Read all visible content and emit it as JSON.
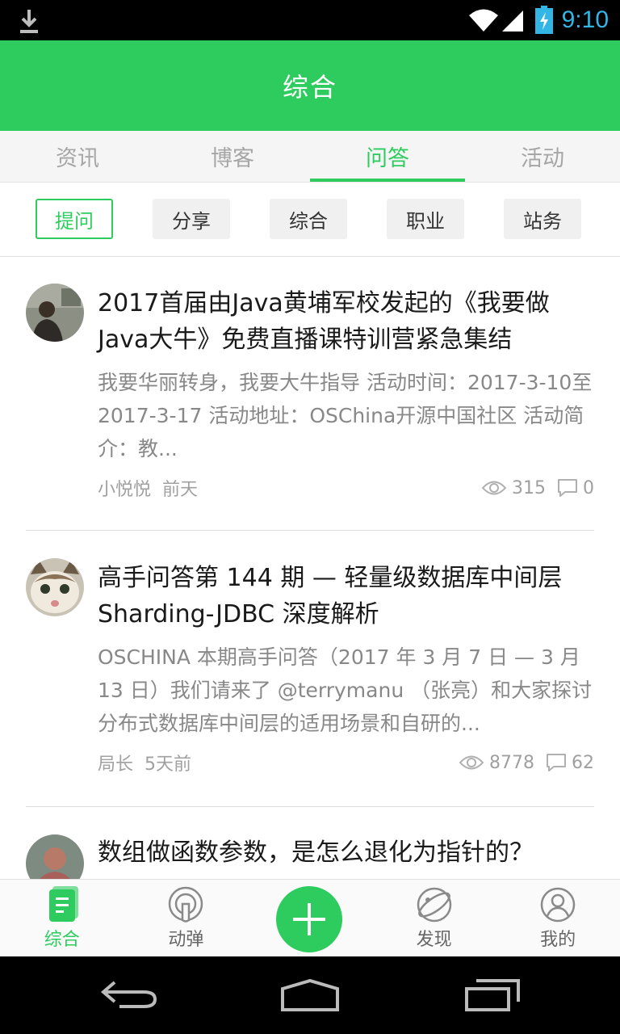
{
  "status_bar": {
    "time": "9:10"
  },
  "header": {
    "title": "综合"
  },
  "tabs": [
    {
      "label": "资讯"
    },
    {
      "label": "博客"
    },
    {
      "label": "问答"
    },
    {
      "label": "活动"
    }
  ],
  "subcategories": [
    {
      "label": "提问"
    },
    {
      "label": "分享"
    },
    {
      "label": "综合"
    },
    {
      "label": "职业"
    },
    {
      "label": "站务"
    }
  ],
  "feed": [
    {
      "title": "2017首届由Java黄埔军校发起的《我要做Java大牛》免费直播课特训营紧急集结",
      "description": "我要华丽转身，我要大牛指导   活动时间：2017-3-10至 2017-3-17 活动地址：OSChina开源中国社区 活动简介：教...",
      "author": "小悦悦",
      "time": "前天",
      "views": "315",
      "comments": "0"
    },
    {
      "title": "高手问答第 144 期 — 轻量级数据库中间层 Sharding-JDBC 深度解析",
      "description": "OSCHINA 本期高手问答（2017 年 3 月 7 日 — 3 月 13 日）我们请来了 @terrymanu （张亮）和大家探讨分布式数据库中间层的适用场景和自研的...",
      "author": "局长",
      "time": "5天前",
      "views": "8778",
      "comments": "62"
    },
    {
      "title": "数组做函数参数，是怎么退化为指针的？"
    }
  ],
  "bottom_nav": [
    {
      "label": "综合"
    },
    {
      "label": "动弹"
    },
    {
      "label": "发现"
    },
    {
      "label": "我的"
    }
  ],
  "colors": {
    "accent": "#2ecc5f",
    "status_time": "#33b5e5"
  },
  "active_tab_index": 2,
  "active_subcategory_index": 0,
  "active_bottom_nav_index": 0
}
